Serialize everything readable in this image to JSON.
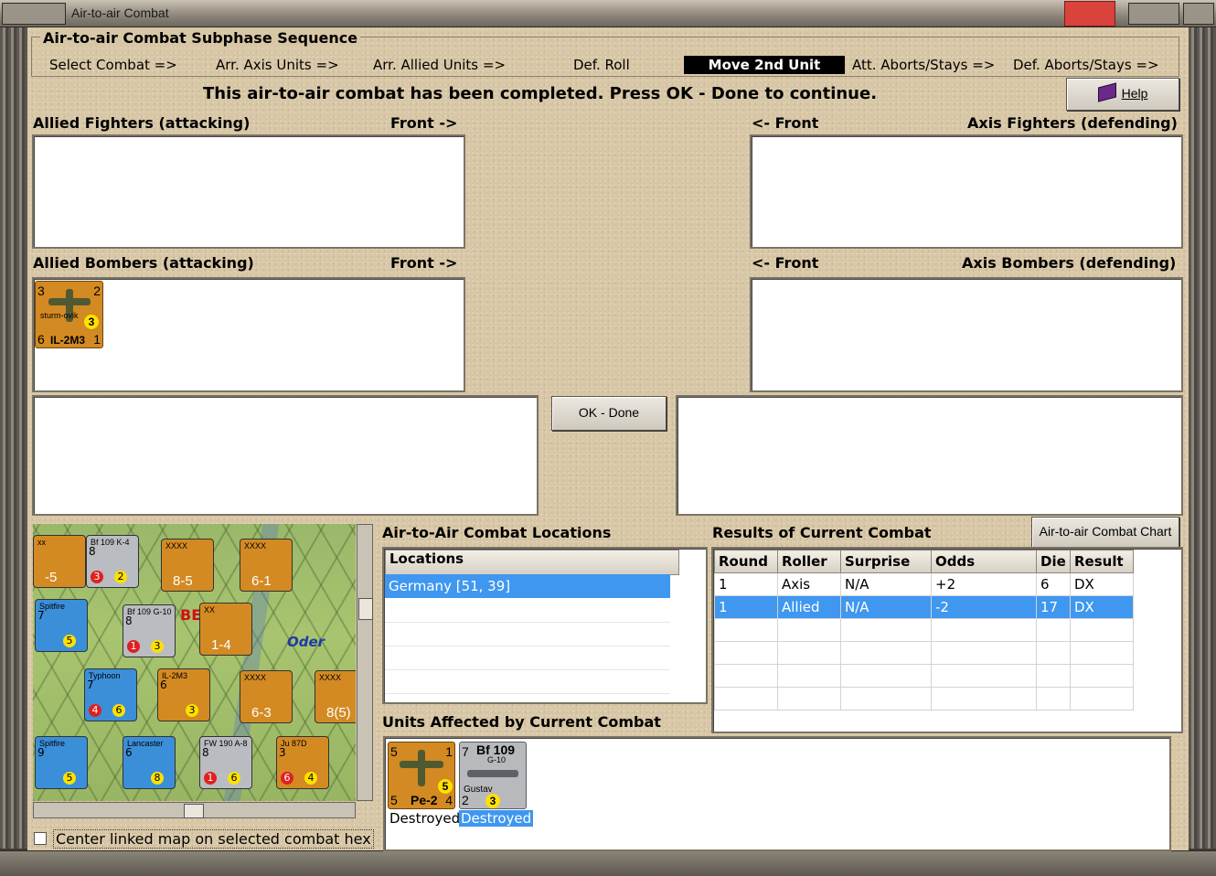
{
  "window": {
    "title": "Air-to-air Combat"
  },
  "sequence": {
    "title": "Air-to-air Combat Subphase Sequence",
    "steps": [
      "Select Combat =>",
      "Arr. Axis Units =>",
      "Arr. Allied Units =>",
      "Def. Roll",
      "Move 2nd Unit",
      "Att. Aborts/Stays =>",
      "Def. Aborts/Stays =>"
    ],
    "active_step": "Move 2nd Unit"
  },
  "status_message": "This air-to-air combat has been completed.  Press OK - Done to continue.",
  "help_button": {
    "label": "Help",
    "icon": "help-book-icon"
  },
  "allied_fighters": {
    "title": "Allied Fighters (attacking)",
    "front": "Front ->"
  },
  "axis_fighters": {
    "title": "Axis Fighters (defending)",
    "front": "<- Front"
  },
  "allied_bombers": {
    "title": "Allied Bombers (attacking)",
    "front": "Front ->",
    "unit": {
      "top_left": "3",
      "top_right": "2",
      "badge": "3",
      "bottom_left": "6",
      "name": "IL-2M3",
      "bottom_right": "1",
      "subtitle": "sturm-ovik"
    }
  },
  "axis_bombers": {
    "title": "Axis Bombers (defending)",
    "front": "<- Front"
  },
  "ok_button": {
    "label": "OK - Done"
  },
  "map": {
    "river_label": "Oder",
    "hex_labels": [
      "BE"
    ],
    "counters": [
      {
        "t": "xx",
        "num": "-5"
      },
      {
        "t": "Bf 109 K-4",
        "a": "8",
        "b": "3",
        "c": "2"
      },
      {
        "t": "XXXX",
        "num": "8-5"
      },
      {
        "t": "XXXX",
        "num": "6-1"
      },
      {
        "t": "Spitfire",
        "a": "7",
        "c": "5"
      },
      {
        "t": "Bf 109 G-10",
        "a": "8",
        "b": "1",
        "c": "3"
      },
      {
        "t": "XX",
        "num": "1-4"
      },
      {
        "t": "Typhoon",
        "a": "7",
        "b": "4",
        "c": "6"
      },
      {
        "t": "IL-2M3",
        "a": "6",
        "c": "3"
      },
      {
        "t": "XXXX",
        "num": "6-3"
      },
      {
        "t": "XXXX",
        "num": "8(5)"
      },
      {
        "t": "Spitfire",
        "a": "9",
        "c": "5"
      },
      {
        "t": "Lancaster",
        "a": "6",
        "c": "8"
      },
      {
        "t": "FW 190 A-8",
        "a": "8",
        "b": "1",
        "c": "6"
      },
      {
        "t": "Ju 87D",
        "a": "3",
        "b": "6",
        "c": "4"
      }
    ]
  },
  "center_map_checkbox": {
    "label": "Center linked map on selected combat hex",
    "checked": false
  },
  "locations": {
    "title": "Air-to-Air Combat Locations",
    "header": "Locations",
    "rows": [
      "Germany [51, 39]"
    ]
  },
  "results": {
    "title": "Results of Current Combat",
    "chart_button": "Air-to-air Combat Chart",
    "headers": [
      "Round",
      "Roller",
      "Surprise",
      "Odds",
      "Die",
      "Result"
    ],
    "rows": [
      [
        "1",
        "Axis",
        "N/A",
        "+2",
        "6",
        "DX"
      ],
      [
        "1",
        "Allied",
        "N/A",
        "-2",
        "17",
        "DX"
      ]
    ]
  },
  "affected": {
    "title": "Units Affected by Current Combat",
    "units": [
      {
        "name": "Pe-2",
        "tl": "5",
        "tr": "1",
        "bl": "5",
        "br": "4",
        "badge": "5",
        "status": "Destroyed"
      },
      {
        "name": "Bf 109",
        "sub": "G-10",
        "model": "Gustav",
        "tl": "7",
        "bl": "2",
        "badge": "3",
        "status": "Destroyed"
      }
    ]
  },
  "colors": {
    "selection": "#3f97f0",
    "parchment": "#d8c7a6",
    "counter_orange": "#d38a22",
    "active_step_bg": "#000000"
  }
}
